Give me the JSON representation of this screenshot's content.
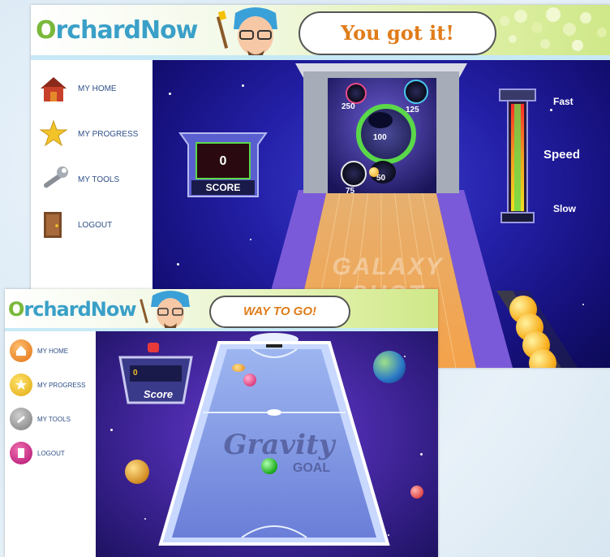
{
  "screen1": {
    "logo": "OrchardNow",
    "speech": "You got it!",
    "nav": [
      {
        "label": "MY HOME",
        "icon": "house-icon"
      },
      {
        "label": "MY PROGRESS",
        "icon": "star-icon"
      },
      {
        "label": "MY TOOLS",
        "icon": "wrench-icon"
      },
      {
        "label": "LOGOUT",
        "icon": "door-icon"
      }
    ],
    "game": {
      "score_value": "0",
      "score_label": "SCORE",
      "targets": [
        "250",
        "125",
        "100",
        "50",
        "75"
      ],
      "speed_fast": "Fast",
      "speed_label": "Speed",
      "speed_slow": "Slow",
      "lane_title": "GALAXY SHOT",
      "balls_remaining": 4
    }
  },
  "screen2": {
    "logo": "OrchardNow",
    "speech": "WAY TO GO!",
    "nav": [
      {
        "label": "MY HOME",
        "icon": "house-icon"
      },
      {
        "label": "MY PROGRESS",
        "icon": "star-icon"
      },
      {
        "label": "MY TOOLS",
        "icon": "wrench-icon"
      },
      {
        "label": "LOGOUT",
        "icon": "door-icon"
      }
    ],
    "game": {
      "score_value": "0",
      "score_label": "Score",
      "title_line1": "Gravity",
      "title_line2": "GOAL"
    }
  },
  "colors": {
    "logo_blue": "#3aa0c8",
    "logo_green": "#7ab83a",
    "speech_orange": "#e07c1a",
    "nav_text": "#2f4f88"
  }
}
